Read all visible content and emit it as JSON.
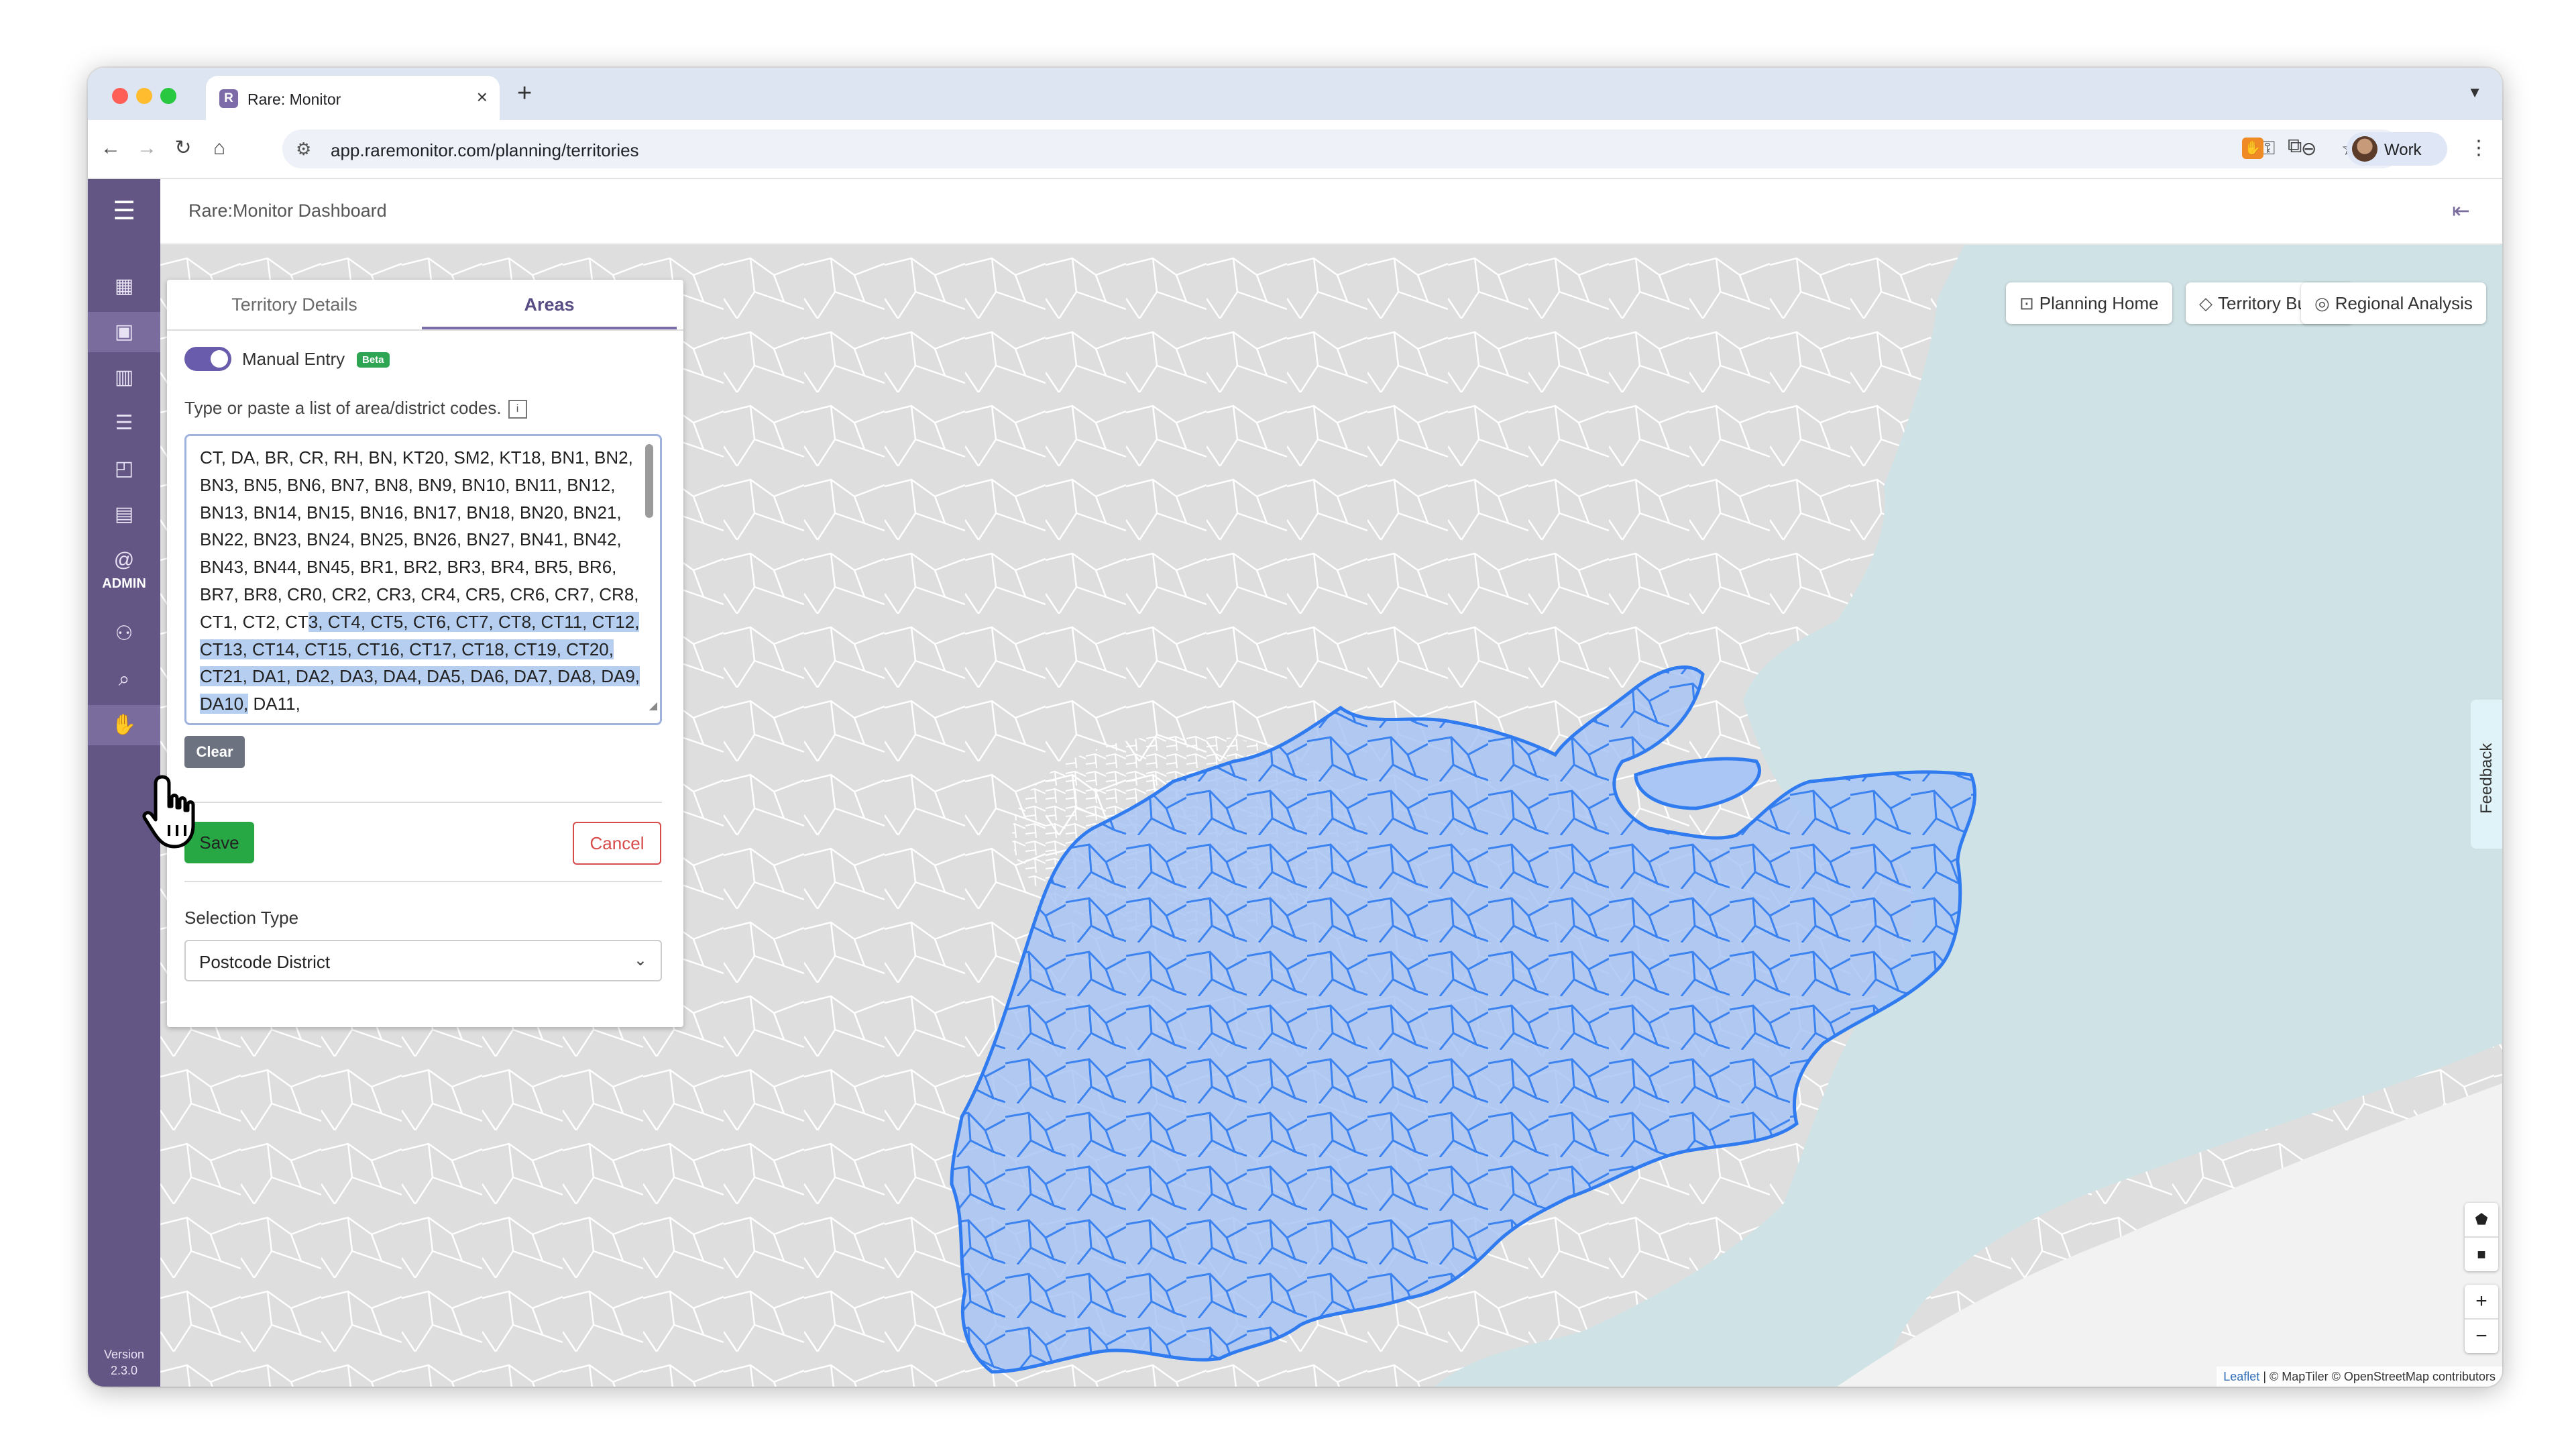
{
  "browser": {
    "tab_title": "Rare: Monitor",
    "favicon_letter": "R",
    "url": "app.raremonitor.com/planning/territories",
    "profile_label": "Work",
    "ext_icon": "hand-icon"
  },
  "app": {
    "title": "Rare:Monitor Dashboard",
    "sidebar": {
      "items": [
        {
          "name": "dashboard-icon"
        },
        {
          "name": "territory-icon"
        },
        {
          "name": "bar-chart-icon"
        },
        {
          "name": "list-icon"
        },
        {
          "name": "report-icon"
        },
        {
          "name": "book-icon"
        },
        {
          "name": "at-sign-icon"
        },
        {
          "name": "users-icon"
        },
        {
          "name": "search-icon"
        },
        {
          "name": "handshake-icon"
        }
      ],
      "admin_label": "ADMIN",
      "version_label": "Version",
      "version_number": "2.3.0"
    }
  },
  "panel": {
    "tabs": [
      "Territory Details",
      "Areas"
    ],
    "active_tab": "Areas",
    "manual_entry_label": "Manual Entry",
    "manual_entry_on": true,
    "beta_badge": "Beta",
    "helper_text": "Type or paste a list of area/district codes.",
    "info_glyph": "i",
    "codes_before_selection": "CT, DA, BR, CR, RH, BN, KT20, SM2, KT18, BN1, BN2, BN3, BN5, BN6, BN7, BN8, BN9, BN10, BN11, BN12, BN13, BN14, BN15, BN16, BN17, BN18, BN20, BN21, BN22, BN23, BN24, BN25, BN26, BN27, BN41, BN42, BN43, BN44, BN45, BR1, BR2, BR3, BR4, BR5, BR6, BR7, BR8, CR0, CR2, CR3, CR4, CR5, CR6, CR7, CR8, CT1, CT2, CT",
    "codes_selected": "3, CT4, CT5, CT6, CT7, CT8, CT11, CT12, CT13, CT14, CT15, CT16, CT17, CT18, CT19, CT20, CT21, DA1, DA2, DA3, DA4, DA5, DA6, DA7, DA8, DA9, DA10,",
    "codes_after_selection": " DA11,",
    "clear_label": "Clear",
    "save_label": "Save",
    "cancel_label": "Cancel",
    "selection_type_label": "Selection Type",
    "selection_type_value": "Postcode District"
  },
  "map": {
    "buttons": [
      {
        "label": "Planning Home",
        "icon": "map-search-icon"
      },
      {
        "label": "Territory Builder",
        "icon": "tag-icon"
      },
      {
        "label": "Regional Analysis",
        "icon": "globe-icon"
      }
    ],
    "feedback_label": "Feedback",
    "attribution_leaflet": "Leaflet",
    "attribution_rest": "| © MapTiler © OpenStreetMap contributors",
    "selection_fill": "#a9c6f5",
    "selection_stroke": "#2f7bef"
  }
}
